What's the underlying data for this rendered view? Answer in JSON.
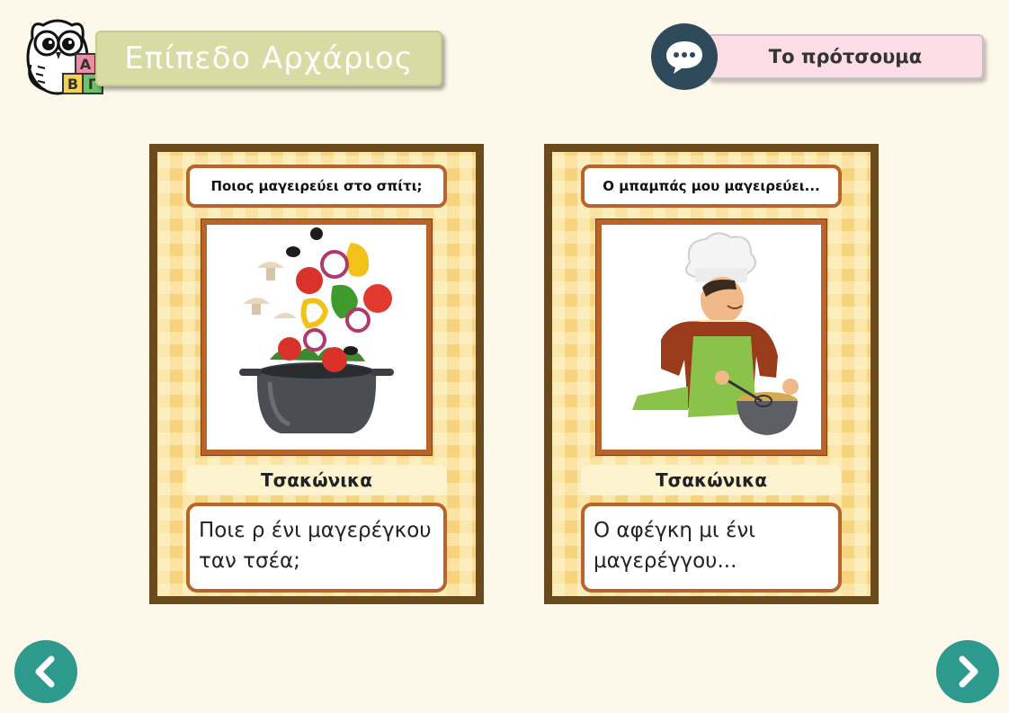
{
  "header": {
    "logo_letters": [
      "Α",
      "Β",
      "Γ"
    ],
    "level_title": "Επίπεδο Αρχάριος",
    "chat_icon": "speech-bubble-icon",
    "original_button_label": "Το πρότσουμα"
  },
  "cards": [
    {
      "question": "Ποιος μαγειρεύει στο σπίτι;",
      "image": "cooking-pot-vegetables",
      "language": "Τσακώνικα",
      "answer_line1": "Ποιε ρ ένι μαγερέγκου",
      "answer_line2": "ταν τσέα;"
    },
    {
      "question": "Ο μπαμπάς μου μαγειρεύει...",
      "image": "chef-whisking-bowl",
      "language": "Τσακώνικα",
      "answer_line1": "Ο αφέγκη μι ένι",
      "answer_line2": "μαγερέγγου..."
    }
  ],
  "navigation": {
    "prev_icon": "chevron-left-icon",
    "next_icon": "chevron-right-icon"
  },
  "colors": {
    "background": "#fdf8e9",
    "level_box": "#d9dba5",
    "original_button": "#fbdde6",
    "chat_button": "#2f4a5a",
    "card_frame": "#6b4a1c",
    "card_fill": "#f7d37e",
    "box_border": "#b8642a",
    "nav_button": "#2e9a8e"
  }
}
